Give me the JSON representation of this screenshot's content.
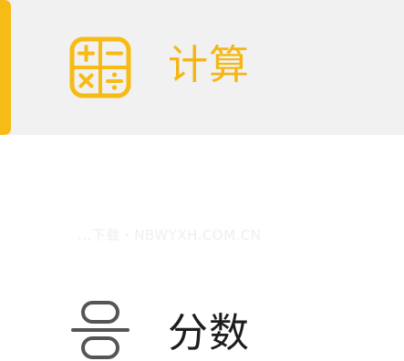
{
  "colors": {
    "accent": "#f7bb16",
    "selected_background": "#f1f1f1",
    "text_primary": "#1d1d1d"
  },
  "menu": {
    "items": [
      {
        "label": "计算",
        "icon": "calculator-icon",
        "selected": true
      },
      {
        "label": "分数",
        "icon": "fraction-icon",
        "selected": false
      }
    ]
  },
  "watermark": {
    "text": "...下载・NBWYXH.COM.CN"
  }
}
